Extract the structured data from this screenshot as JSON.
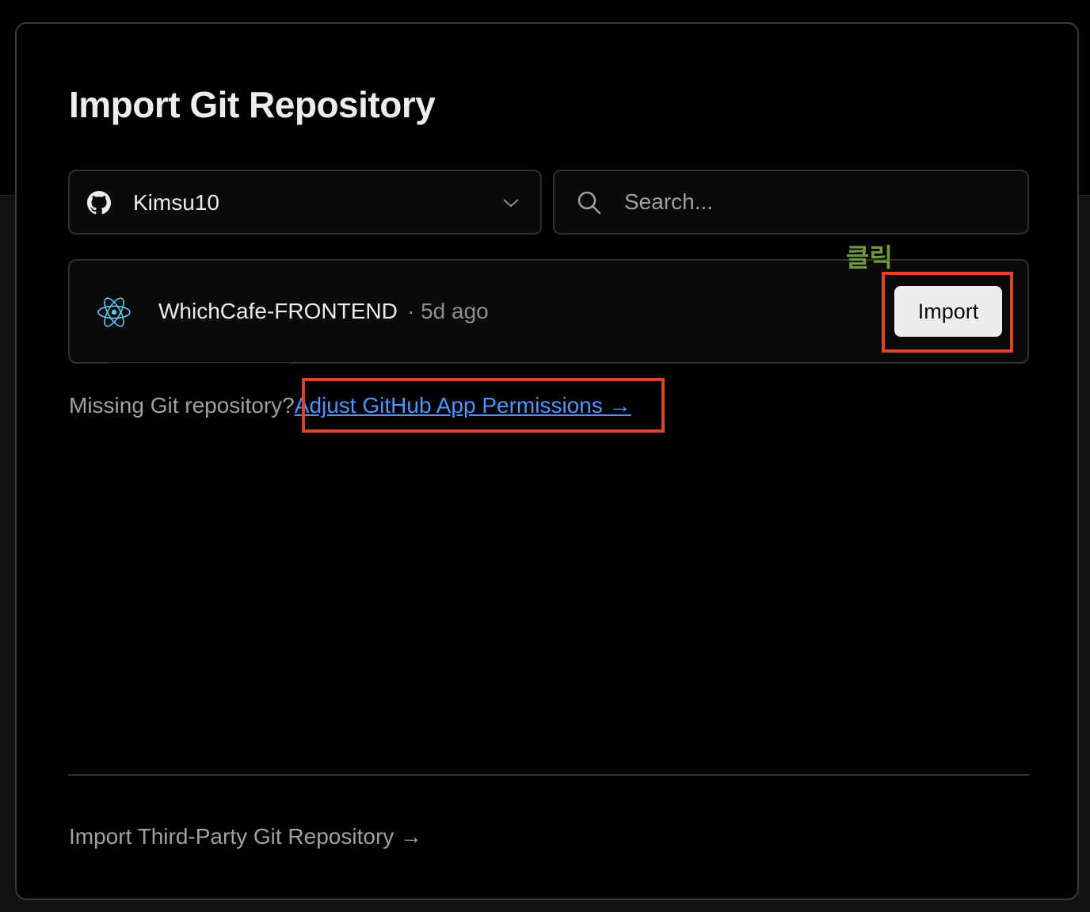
{
  "dialog": {
    "title": "Import Git Repository"
  },
  "account_select": {
    "value": "Kimsu10",
    "icon": "github-icon"
  },
  "search": {
    "placeholder": "Search..."
  },
  "repositories": [
    {
      "name": "WhichCafe-FRONTEND",
      "meta": "· 5d ago",
      "framework_icon": "react-icon",
      "action_label": "Import"
    }
  ],
  "annotation": {
    "click_label": "클릭",
    "highlight_color": "#e0432a",
    "label_color": "#6f9a3c"
  },
  "missing": {
    "text": "Missing Git repository?",
    "link_label": "Adjust GitHub App Permissions →"
  },
  "footer": {
    "third_party_label": "Import Third-Party Git Repository →"
  },
  "colors": {
    "background": "#000000",
    "link": "#5294ff",
    "button_bg": "#ededed"
  }
}
